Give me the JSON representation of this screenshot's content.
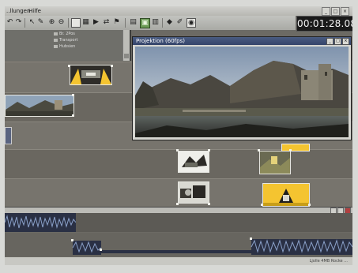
{
  "menu": {
    "items": [
      "..llungen",
      "Hilfe"
    ]
  },
  "timecode": "00:01:28.08",
  "project_panel": {
    "items": [
      "Br. 2Pos",
      "Transport",
      "Hubsien"
    ]
  },
  "preview": {
    "title": "Projektion (60fps)"
  },
  "statusbar": {
    "text": "Ljolle  4MB Rocke ..."
  },
  "colors": {
    "clip_yellow": "#f4c430",
    "timeline_bg": "#77746d",
    "preview_title": "#3f5078",
    "audio_wave": "#8aa0c8"
  }
}
